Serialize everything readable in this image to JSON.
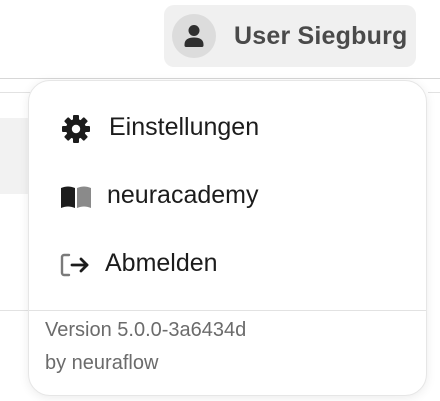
{
  "header": {
    "user_name": "User Siegburg",
    "avatar_icon": "person-icon"
  },
  "menu": {
    "items": [
      {
        "label": "Einstellungen",
        "icon": "gear-icon"
      },
      {
        "label": "neuracademy",
        "icon": "book-icon"
      },
      {
        "label": "Abmelden",
        "icon": "logout-icon"
      }
    ],
    "version_text": "Version 5.0.0-3a6434d",
    "byline_text": "by neuraflow"
  },
  "colors": {
    "user_button_bg": "#f0f0f0",
    "avatar_bg": "#dcdcdc",
    "text_primary": "#1c1c1c",
    "text_secondary": "#6b6b6b"
  }
}
